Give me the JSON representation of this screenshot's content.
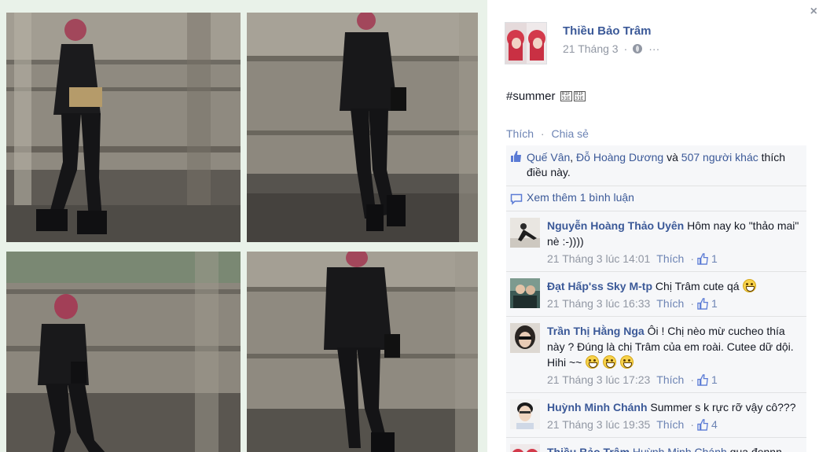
{
  "post": {
    "author": "Thiều Bảo Trâm",
    "date": "21 Tháng 3",
    "meta_sep": "·",
    "privacy_icon": "globe-icon",
    "more_dots": "···",
    "text": "#summer",
    "close": "×"
  },
  "actions": {
    "like": "Thích",
    "dot": "·",
    "share": "Chia sẻ"
  },
  "likes": {
    "names_1": "Quế Vân",
    "sep_1": ", ",
    "names_2": "Đỗ Hoàng Dương",
    "and": " và ",
    "others": "507 người khác",
    "suffix": " thích điều này."
  },
  "more_comments": "Xem thêm 1 bình luận",
  "comments": [
    {
      "name": "Nguyễn Hoàng Thảo Uyên",
      "text": " Hôm nay ko \"thảo mai\" nè :-))))",
      "time": "21 Tháng 3 lúc 14:01",
      "like": "Thích",
      "count": "1"
    },
    {
      "name": "Đạt Hấp'ss Sky M-tp",
      "text": " Chị Trâm cute qá",
      "time": "21 Tháng 3 lúc 16:33",
      "like": "Thích",
      "count": "1"
    },
    {
      "name": "Trần Thị Hằng Nga",
      "text": " Ôi ! Chị nèo mừ cucheo thía này ? Đúng là chị Trâm của em roài. Cutee dữ dội. Hihi ~~",
      "time": "21 Tháng 3 lúc 17:23",
      "like": "Thích",
      "count": "1"
    },
    {
      "name": "Huỳnh Minh Chánh",
      "text": " Summer s k rực rỡ vậy cô???",
      "time": "21 Tháng 3 lúc 19:35",
      "like": "Thích",
      "count": "4"
    },
    {
      "name": "Thiều Bảo Trâm",
      "reply_to": " Huỳnh Minh Chánh",
      "text": " qụa đennn"
    }
  ],
  "colors": {
    "link": "#3b5998",
    "muted": "#9197a3",
    "panel_bg": "#f6f7f9",
    "photo_bg": "#e9f2e9"
  }
}
